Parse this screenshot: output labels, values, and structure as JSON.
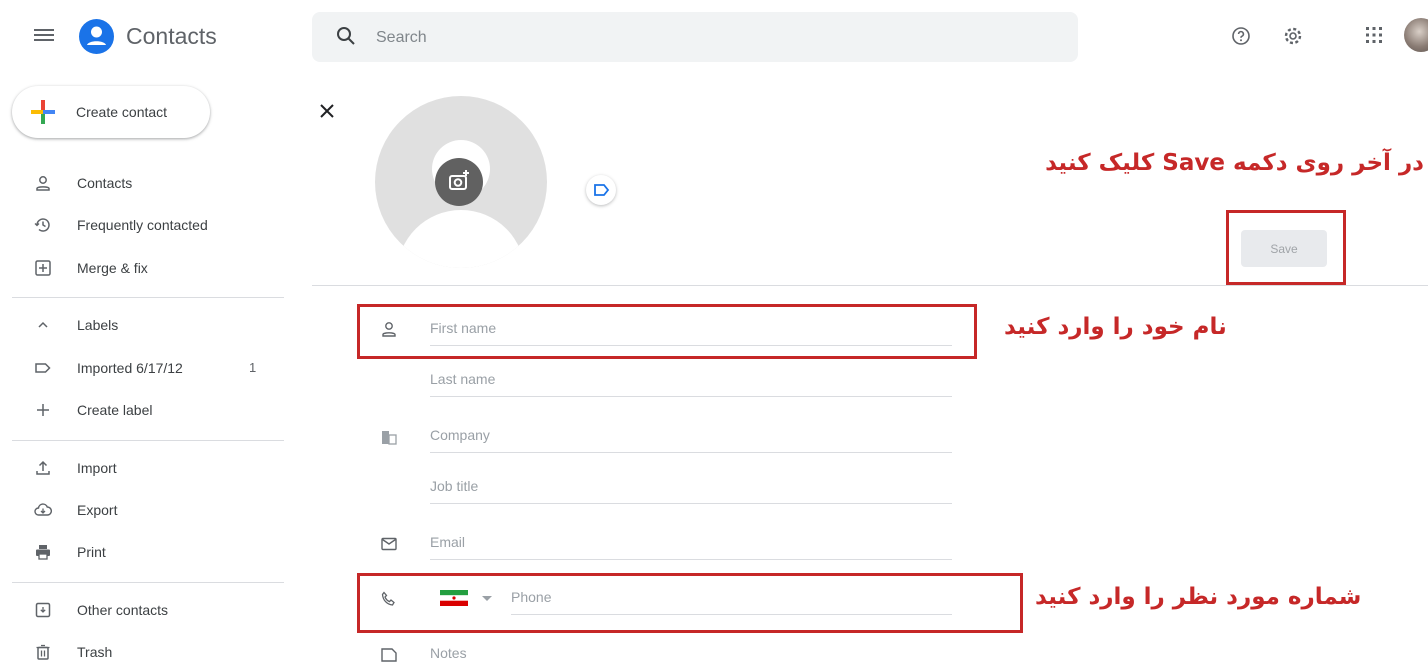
{
  "header": {
    "app_title": "Contacts",
    "search_placeholder": "Search",
    "brand_color": "#1a73e8"
  },
  "sidebar": {
    "create_label": "Create contact",
    "items": [
      {
        "label": "Contacts",
        "icon": "person-icon"
      },
      {
        "label": "Frequently contacted",
        "icon": "history-icon"
      },
      {
        "label": "Merge & fix",
        "icon": "merge-icon"
      },
      {
        "label": "Labels",
        "icon": "chevron-up-icon"
      },
      {
        "label": "Imported 6/17/12",
        "icon": "label-icon",
        "count": "1"
      },
      {
        "label": "Create label",
        "icon": "plus-icon"
      },
      {
        "label": "Import",
        "icon": "upload-icon"
      },
      {
        "label": "Export",
        "icon": "cloud-download-icon"
      },
      {
        "label": "Print",
        "icon": "printer-icon"
      },
      {
        "label": "Other contacts",
        "icon": "archive-icon"
      },
      {
        "label": "Trash",
        "icon": "trash-icon"
      }
    ]
  },
  "form": {
    "save_label": "Save",
    "first_name_placeholder": "First name",
    "last_name_placeholder": "Last name",
    "company_placeholder": "Company",
    "job_title_placeholder": "Job title",
    "email_placeholder": "Email",
    "phone_placeholder": "Phone",
    "notes_placeholder": "Notes",
    "phone_country_flag": "iran-flag-icon"
  },
  "annotations": {
    "save_hint": "در آخر روی دکمه Save کلیک کنید",
    "name_hint": "نام خود را وارد کنید",
    "phone_hint": "شماره مورد نظر را وارد کنید",
    "color": "#c62828"
  }
}
